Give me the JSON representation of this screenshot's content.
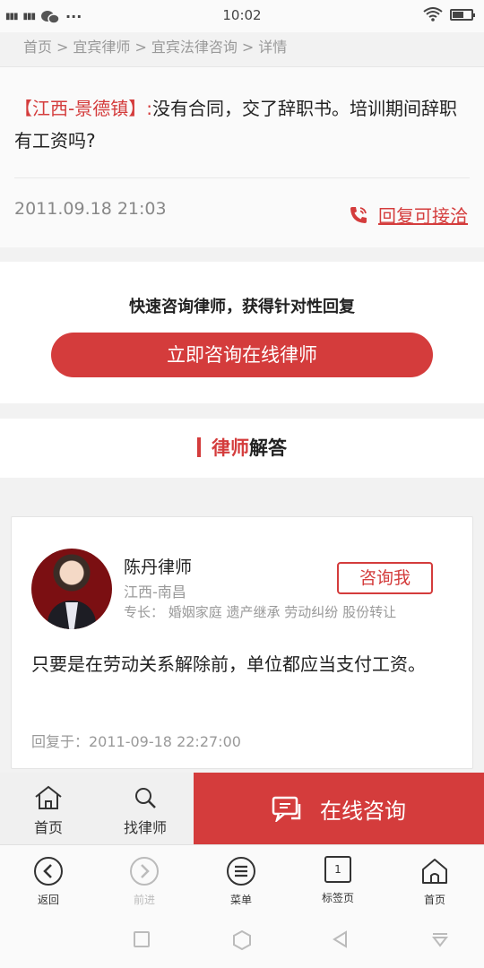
{
  "status": {
    "left": "Yil  Eil",
    "time": "10:02"
  },
  "breadcrumb": [
    "首页",
    "宜宾律师",
    "宜宾法律咨询",
    "详情"
  ],
  "question": {
    "location": "【江西-景德镇】:",
    "text": "没有合同，交了辞职书。培训期间辞职有工资吗?",
    "date": "2011.09.18 21:03",
    "reply_label": "回复可接洽"
  },
  "cta": {
    "tip": "快速咨询律师，获得针对性回复",
    "button": "立即咨询在线律师"
  },
  "section": {
    "title_red": "律师",
    "title_black": "解答"
  },
  "lawyer": {
    "name": "陈丹律师",
    "region": "江西-南昌",
    "specialty": "专长：  婚姻家庭 遗产继承 劳动纠纷 股份转让",
    "consult_label": "咨询我",
    "answer": "只要是在劳动关系解除前，单位都应当支付工资。",
    "reply_time": "回复于：2011-09-18 22:27:00"
  },
  "bottom_bar": {
    "home": "首页",
    "find": "找律师",
    "online": "在线咨询"
  },
  "browser": {
    "back": "返回",
    "forward": "前进",
    "menu": "菜单",
    "tabs": "标签页",
    "tab_count": "1",
    "home": "首页"
  },
  "colors": {
    "accent": "#d43c3c"
  }
}
